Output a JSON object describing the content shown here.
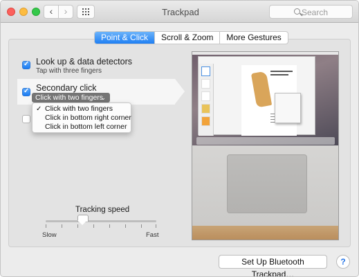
{
  "window": {
    "title": "Trackpad"
  },
  "toolbar": {
    "back_icon": "‹",
    "forward_icon": "›",
    "search_placeholder": "Search"
  },
  "tabs": [
    {
      "label": "Point & Click",
      "active": true
    },
    {
      "label": "Scroll & Zoom",
      "active": false
    },
    {
      "label": "More Gestures",
      "active": false
    }
  ],
  "options": {
    "lookup": {
      "title": "Look up & data detectors",
      "subtitle": "Tap with three fingers",
      "checked": true
    },
    "secondary": {
      "title": "Secondary click",
      "selected": "Click with two fingers",
      "checked": true
    },
    "third": {
      "checked": false
    }
  },
  "secondary_menu": {
    "checkmark": "✓",
    "items": [
      "Click with two fingers",
      "Click in bottom right corner",
      "Click in bottom left corner"
    ],
    "selected_index": 0
  },
  "tracking": {
    "title": "Tracking speed",
    "min_label": "Slow",
    "max_label": "Fast",
    "value_fraction": 0.33
  },
  "buttons": {
    "setup_bluetooth": "Set Up Bluetooth Trackpad…",
    "help": "?"
  },
  "colors": {
    "accent": "#1f7ff3",
    "checkbox": "#1a7cf2",
    "popup": "#757575"
  }
}
